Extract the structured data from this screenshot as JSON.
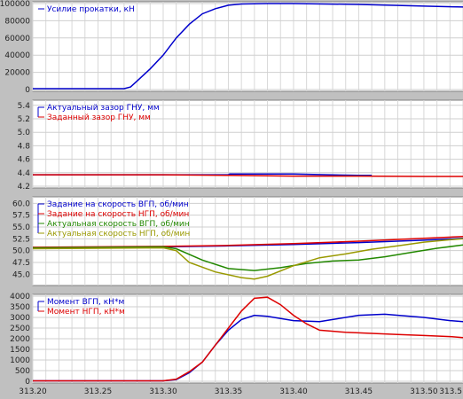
{
  "chart_data": [
    {
      "type": "line",
      "ylim": [
        0,
        100000
      ],
      "yticks": [
        "0",
        "20000",
        "40000",
        "60000",
        "80000",
        "100000"
      ],
      "ytick_values": [
        0,
        20000,
        40000,
        60000,
        80000,
        100000
      ],
      "xlim": [
        313.2,
        313.53
      ],
      "grid": true,
      "legend_position": "top-left",
      "series": [
        {
          "name": "Усилие прокатки, кН",
          "color": "#0000cc",
          "x": [
            313.2,
            313.25,
            313.27,
            313.275,
            313.28,
            313.29,
            313.3,
            313.31,
            313.32,
            313.33,
            313.34,
            313.35,
            313.36,
            313.38,
            313.4,
            313.45,
            313.5,
            313.53
          ],
          "y": [
            1000,
            1000,
            1000,
            3000,
            10000,
            24000,
            40000,
            60000,
            76000,
            88000,
            94000,
            98000,
            99500,
            100000,
            100000,
            99000,
            97000,
            96000
          ]
        }
      ]
    },
    {
      "type": "line",
      "ylim": [
        4.2,
        5.45
      ],
      "yticks": [
        "4.2",
        "4.4",
        "4.6",
        "4.8",
        "5.0",
        "5.2",
        "5.4"
      ],
      "ytick_values": [
        4.2,
        4.4,
        4.6,
        4.8,
        5.0,
        5.2,
        5.4
      ],
      "xlim": [
        313.2,
        313.53
      ],
      "grid": true,
      "legend_position": "top-left",
      "series": [
        {
          "name": "Актуальный зазор ГНУ, мм",
          "color": "#0000cc",
          "x": [
            313.2,
            313.35,
            313.351,
            313.4,
            313.45,
            313.46
          ],
          "y": [
            4.37,
            4.37,
            4.38,
            4.38,
            4.36,
            4.36
          ]
        },
        {
          "name": "Заданный зазор ГНУ, мм",
          "color": "#dd0000",
          "x": [
            313.2,
            313.3,
            313.35,
            313.4,
            313.45,
            313.5,
            313.53
          ],
          "y": [
            4.37,
            4.37,
            4.36,
            4.35,
            4.35,
            4.345,
            4.345
          ]
        }
      ]
    },
    {
      "type": "line",
      "ylim": [
        43,
        61
      ],
      "yticks": [
        "45.0",
        "47.5",
        "50.0",
        "52.5",
        "55.0",
        "57.5",
        "60.0"
      ],
      "ytick_values": [
        45,
        47.5,
        50,
        52.5,
        55,
        57.5,
        60
      ],
      "xlim": [
        313.2,
        313.53
      ],
      "grid": true,
      "legend_position": "top-left",
      "series": [
        {
          "name": "Задание на скорость ВГП, об/мин",
          "color": "#0000cc",
          "x": [
            313.2,
            313.3,
            313.35,
            313.4,
            313.45,
            313.5,
            313.53
          ],
          "y": [
            50.6,
            50.8,
            51.0,
            51.3,
            51.7,
            52.2,
            52.6
          ]
        },
        {
          "name": "Задание на скорость НГП, об/мин",
          "color": "#dd0000",
          "x": [
            313.2,
            313.3,
            313.35,
            313.4,
            313.45,
            313.5,
            313.53
          ],
          "y": [
            50.7,
            50.9,
            51.1,
            51.5,
            52.0,
            52.6,
            53.0
          ]
        },
        {
          "name": "Актуальная скорость ВГП, об/мин",
          "color": "#228800",
          "x": [
            313.2,
            313.3,
            313.31,
            313.33,
            313.35,
            313.37,
            313.39,
            313.41,
            313.43,
            313.45,
            313.47,
            313.49,
            313.51,
            313.53
          ],
          "y": [
            50.6,
            50.8,
            50.4,
            48.0,
            46.2,
            45.8,
            46.4,
            47.3,
            47.8,
            48.0,
            48.7,
            49.6,
            50.5,
            51.2
          ]
        },
        {
          "name": "Актуальная скорость НГП, об/мин",
          "color": "#999900",
          "x": [
            313.2,
            313.3,
            313.31,
            313.32,
            313.34,
            313.36,
            313.37,
            313.38,
            313.4,
            313.42,
            313.44,
            313.46,
            313.48,
            313.5,
            313.52,
            313.53
          ],
          "y": [
            50.4,
            50.6,
            50.0,
            47.5,
            45.5,
            44.3,
            44.0,
            44.6,
            46.8,
            48.5,
            49.3,
            50.3,
            51.0,
            51.8,
            52.3,
            52.5
          ]
        }
      ]
    },
    {
      "type": "line",
      "ylim": [
        0,
        4000
      ],
      "yticks": [
        "0",
        "500",
        "1000",
        "1500",
        "2000",
        "2500",
        "3000",
        "3500",
        "4000"
      ],
      "ytick_values": [
        0,
        500,
        1000,
        1500,
        2000,
        2500,
        3000,
        3500,
        4000
      ],
      "xlim": [
        313.2,
        313.53
      ],
      "xticks": [
        "313.20",
        "313.25",
        "313.30",
        "313.35",
        "313.40",
        "313.45",
        "313.50",
        "313.5"
      ],
      "xtick_values": [
        313.2,
        313.25,
        313.3,
        313.35,
        313.4,
        313.45,
        313.5,
        313.53
      ],
      "grid": true,
      "legend_position": "top-left",
      "series": [
        {
          "name": "Момент ВГП, кН*м",
          "color": "#0000cc",
          "x": [
            313.2,
            313.3,
            313.31,
            313.32,
            313.33,
            313.34,
            313.35,
            313.36,
            313.37,
            313.38,
            313.4,
            313.42,
            313.43,
            313.45,
            313.47,
            313.5,
            313.52,
            313.53
          ],
          "y": [
            20,
            20,
            80,
            400,
            900,
            1700,
            2400,
            2900,
            3100,
            3050,
            2850,
            2800,
            2900,
            3100,
            3150,
            3000,
            2850,
            2800
          ]
        },
        {
          "name": "Момент НГП, кН*м",
          "color": "#dd0000",
          "x": [
            313.2,
            313.3,
            313.31,
            313.32,
            313.33,
            313.34,
            313.35,
            313.36,
            313.37,
            313.38,
            313.39,
            313.4,
            313.41,
            313.42,
            313.44,
            313.46,
            313.48,
            313.5,
            313.52,
            313.53
          ],
          "y": [
            20,
            20,
            100,
            450,
            900,
            1700,
            2500,
            3300,
            3900,
            3950,
            3600,
            3100,
            2700,
            2400,
            2300,
            2250,
            2200,
            2150,
            2100,
            2050
          ]
        }
      ]
    }
  ]
}
